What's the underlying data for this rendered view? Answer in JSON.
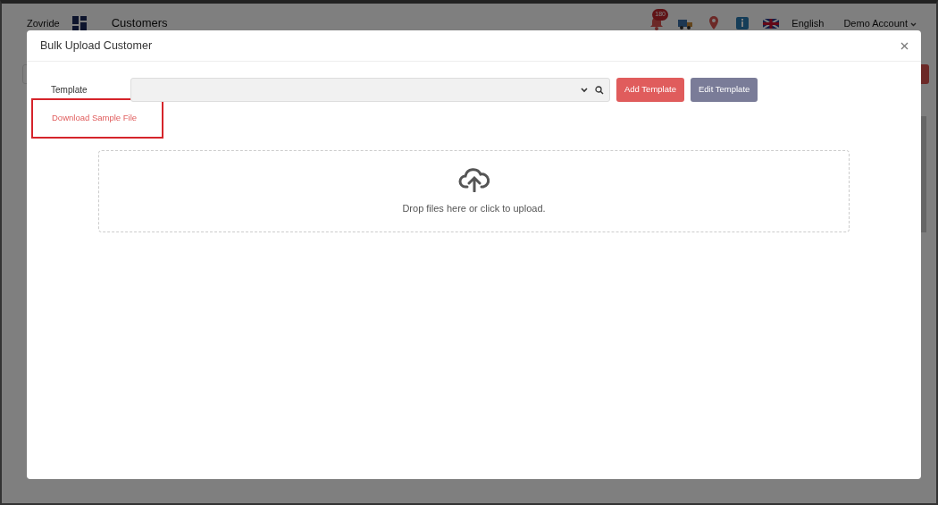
{
  "app_header": {
    "brand": "Zovride",
    "page_title": "Customers",
    "notification_count": "180",
    "language": "English",
    "account": "Demo Account"
  },
  "modal": {
    "title": "Bulk Upload Customer",
    "template_label": "Template",
    "buttons": [
      {
        "label": "Add Template",
        "kind": "primary"
      },
      {
        "label": "Edit Template",
        "kind": "secondary"
      }
    ],
    "download_link": {
      "label": "Download Sample File",
      "highlighted": true
    },
    "dropzone": {
      "text": "Drop files here or click to upload."
    }
  }
}
